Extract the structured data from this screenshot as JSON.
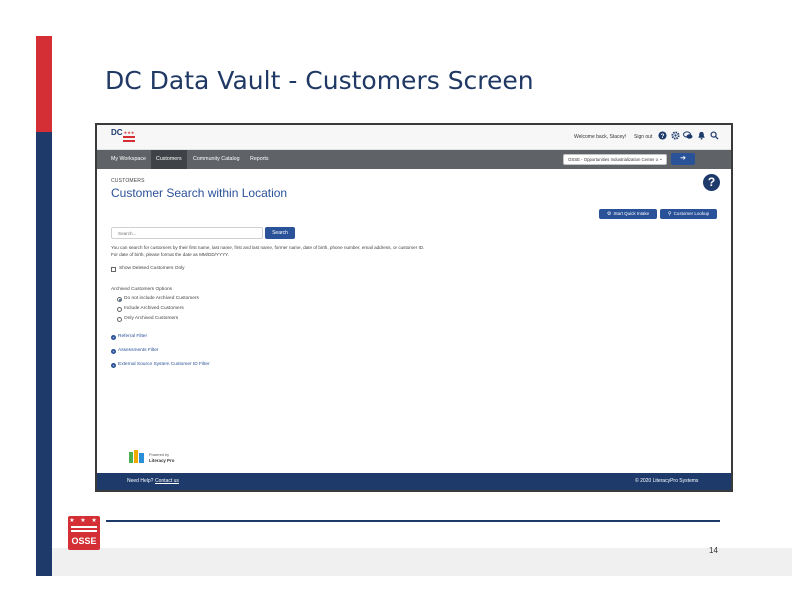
{
  "slide": {
    "title": "DC Data Vault - Customers Screen",
    "page_number": "14",
    "logo_text": "OSSE",
    "logo_stars": "★ ★ ★"
  },
  "app": {
    "logo_letters": "DC",
    "logo_stars": "★★★",
    "header": {
      "welcome": "Welcome back, Stacey!",
      "sign_out": "Sign out"
    },
    "nav": {
      "items": [
        {
          "label": "My Workspace",
          "active": false
        },
        {
          "label": "Customers",
          "active": true
        },
        {
          "label": "Community Catalog",
          "active": false
        },
        {
          "label": "Reports",
          "active": false
        }
      ],
      "location_value": "OSSE - Opportunities Industrialization Center o",
      "go_glyph": "➔"
    },
    "page": {
      "breadcrumb": "CUSTOMERS",
      "title": "Customer Search within Location",
      "help_glyph": "?"
    },
    "actions": {
      "quick_intake": "Start Quick Intake",
      "customer_lookup": "Customer Lookup"
    },
    "search": {
      "placeholder": "Search...",
      "button": "Search"
    },
    "help_lines": [
      "You can search for customers by their first name, last name, first and last name, former name, date of birth, phone number, email address, or customer ID.",
      "For date of birth, please format the date as MM/DD/YYYY."
    ],
    "show_deleted_label": "Show Deleted Customers Only",
    "archived": {
      "section_label": "Archived Customers Options",
      "options": [
        {
          "label": "Do not include Archived Customers",
          "checked": true
        },
        {
          "label": "Include Archived Customers",
          "checked": false
        },
        {
          "label": "Only Archived Customers",
          "checked": false
        }
      ]
    },
    "filters": [
      {
        "label": "Referral Filter"
      },
      {
        "label": "Assessments Filter"
      },
      {
        "label": "External Source System Customer ID Filter"
      }
    ],
    "powered_by": {
      "line1": "Powered by",
      "brand": "Literacy Pro"
    },
    "footer": {
      "need_help": "Need Help?",
      "contact": "Contact us",
      "copyright": "© 2020 LiteracyPro Systems"
    },
    "colors": {
      "primary": "#2a5298",
      "nav": "#5f6368",
      "footer": "#1d3a6b",
      "brand_red": "#d32f35"
    }
  }
}
